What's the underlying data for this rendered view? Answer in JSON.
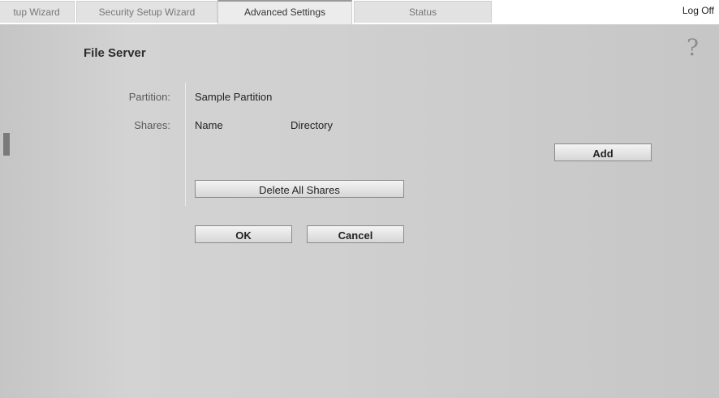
{
  "tabs": [
    {
      "label": "tup Wizard"
    },
    {
      "label": "Security Setup Wizard"
    },
    {
      "label": "Advanced Settings"
    },
    {
      "label": "Status"
    }
  ],
  "header": {
    "logoff_label": "Log Off"
  },
  "help": {
    "glyph": "?"
  },
  "page": {
    "title": "File Server"
  },
  "form": {
    "partition_label": "Partition:",
    "partition_value": "Sample Partition",
    "shares_label": "Shares:",
    "shares_columns": [
      "Name",
      "Directory"
    ]
  },
  "buttons": {
    "add": "Add",
    "delete_all": "Delete All Shares",
    "ok": "OK",
    "cancel": "Cancel"
  }
}
